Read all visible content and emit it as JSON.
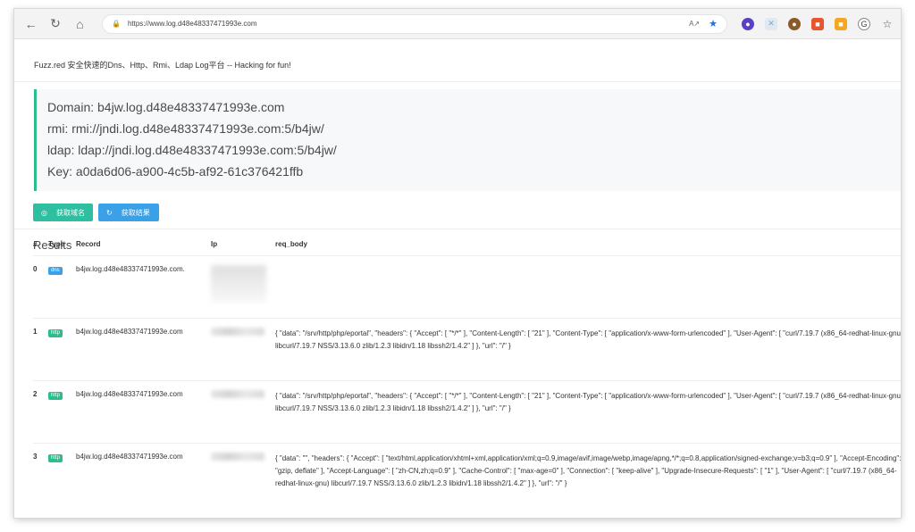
{
  "browser": {
    "url": "https://www.log.d48e48337471993e.com"
  },
  "tagline": "Fuzz.red 安全快速的Dns、Http、Rmi、Ldap Log平台 -- Hacking for fun!",
  "info": {
    "domain": "Domain: b4jw.log.d48e48337471993e.com",
    "rmi": "rmi: rmi://jndi.log.d48e48337471993e.com:5/b4jw/",
    "ldap": "ldap: ldap://jndi.log.d48e48337471993e.com:5/b4jw/",
    "key": "Key: a0da6d06-a900-4c5b-af92-61c376421ffb"
  },
  "buttons": {
    "get_domain": "获取域名",
    "get_results": "获取结果"
  },
  "results": {
    "title": "Results",
    "headers": [
      "#",
      "Type",
      "Record",
      "Ip",
      "req_body"
    ],
    "rows": [
      {
        "num": "0",
        "type": "dns",
        "record": "b4jw.log.d48e48337471993e.com.",
        "body": ""
      },
      {
        "num": "1",
        "type": "http",
        "record": "b4jw.log.d48e48337471993e.com",
        "body": "{ \"data\": \"/srv/http/php/eportal\", \"headers\": { \"Accept\": [ \"*/*\" ], \"Content-Length\": [ \"21\" ], \"Content-Type\": [ \"application/x-www-form-urlencoded\" ], \"User-Agent\": [ \"curl/7.19.7 (x86_64-redhat-linux-gnu) libcurl/7.19.7 NSS/3.13.6.0 zlib/1.2.3 libidn/1.18 libssh2/1.4.2\" ] }, \"url\": \"/\" }"
      },
      {
        "num": "2",
        "type": "http",
        "record": "b4jw.log.d48e48337471993e.com",
        "body": "{ \"data\": \"/srv/http/php/eportal\", \"headers\": { \"Accept\": [ \"*/*\" ], \"Content-Length\": [ \"21\" ], \"Content-Type\": [ \"application/x-www-form-urlencoded\" ], \"User-Agent\": [ \"curl/7.19.7 (x86_64-redhat-linux-gnu) libcurl/7.19.7 NSS/3.13.6.0 zlib/1.2.3 libidn/1.18 libssh2/1.4.2\" ] }, \"url\": \"/\" }"
      },
      {
        "num": "3",
        "type": "http",
        "record": "b4jw.log.d48e48337471993e.com",
        "body": "{ \"data\": \"\", \"headers\": { \"Accept\": [ \"text/html,application/xhtml+xml,application/xml;q=0.9,image/avif,image/webp,image/apng,*/*;q=0.8,application/signed-exchange;v=b3;q=0.9\" ], \"Accept-Encoding\": [ \"gzip, deflate\" ], \"Accept-Language\": [ \"zh-CN,zh;q=0.9\" ], \"Cache-Control\": [ \"max-age=0\" ], \"Connection\": [ \"keep-alive\" ], \"Upgrade-Insecure-Requests\": [ \"1\" ], \"User-Agent\": [ \"curl/7.19.7 (x86_64-redhat-linux-gnu) libcurl/7.19.7 NSS/3.13.6.0 zlib/1.2.3 libidn/1.18 libssh2/1.4.2\" ] }, \"url\": \"/\" }"
      }
    ]
  },
  "colors": {
    "accent_green": "#2dbd8c",
    "accent_blue": "#3aa0e8"
  }
}
